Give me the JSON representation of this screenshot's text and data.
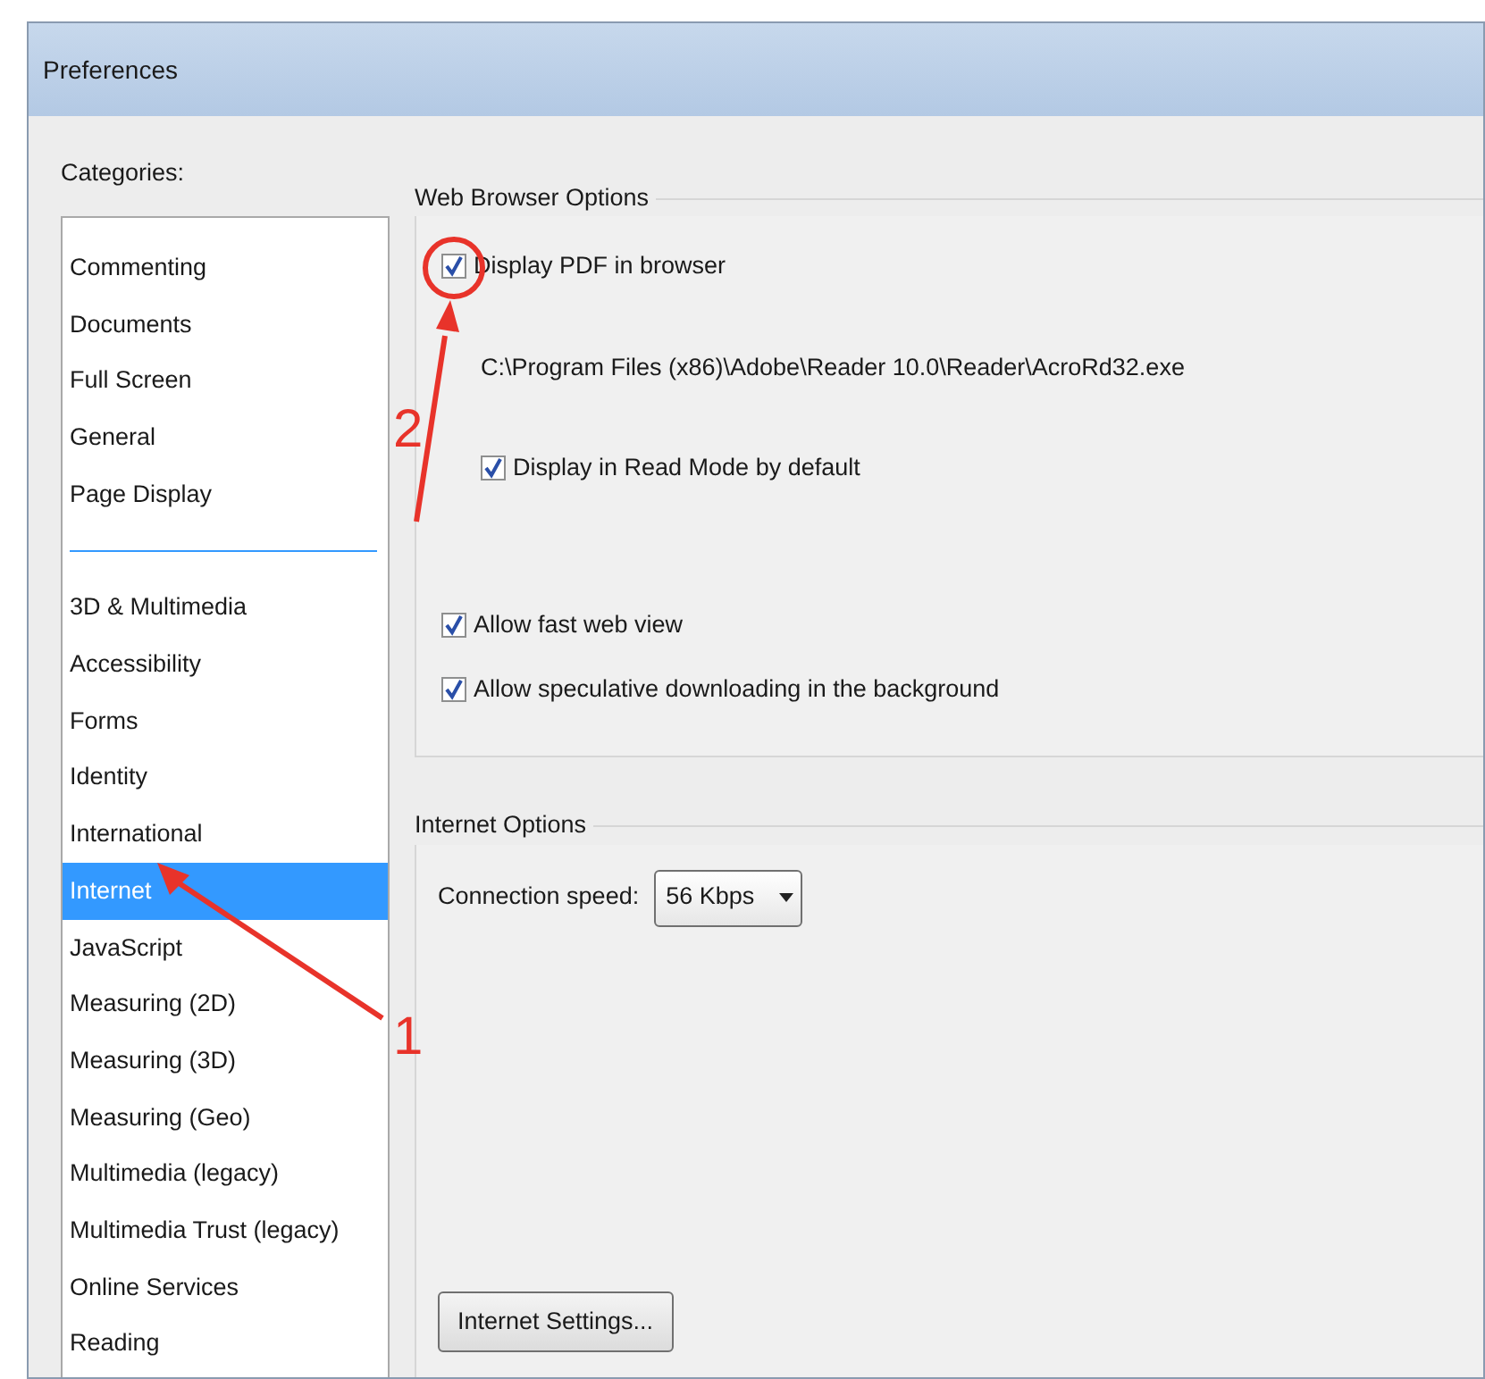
{
  "window": {
    "title": "Preferences"
  },
  "categories": {
    "label": "Categories:",
    "groups": [
      [
        {
          "label": "Commenting",
          "selected": false
        },
        {
          "label": "Documents",
          "selected": false
        },
        {
          "label": "Full Screen",
          "selected": false
        },
        {
          "label": "General",
          "selected": false
        },
        {
          "label": "Page Display",
          "selected": false
        }
      ],
      [
        {
          "label": "3D & Multimedia",
          "selected": false
        },
        {
          "label": "Accessibility",
          "selected": false
        },
        {
          "label": "Forms",
          "selected": false
        },
        {
          "label": "Identity",
          "selected": false
        },
        {
          "label": "International",
          "selected": false
        },
        {
          "label": "Internet",
          "selected": true
        },
        {
          "label": "JavaScript",
          "selected": false
        },
        {
          "label": "Measuring (2D)",
          "selected": false
        },
        {
          "label": "Measuring (3D)",
          "selected": false
        },
        {
          "label": "Measuring (Geo)",
          "selected": false
        },
        {
          "label": "Multimedia (legacy)",
          "selected": false
        },
        {
          "label": "Multimedia Trust (legacy)",
          "selected": false
        },
        {
          "label": "Online Services",
          "selected": false
        },
        {
          "label": "Reading",
          "selected": false
        }
      ]
    ]
  },
  "web_browser_options": {
    "title": "Web Browser Options",
    "browser_options": [
      {
        "kind": "checkbox",
        "label": "Display PDF in browser",
        "checked": true
      },
      {
        "kind": "path",
        "label": "C:\\Program Files (x86)\\Adobe\\Reader 10.0\\Reader\\AcroRd32.exe"
      },
      {
        "kind": "subcheckbox",
        "label": "Display in Read Mode by default",
        "checked": true
      }
    ],
    "download_options": [
      {
        "kind": "checkbox",
        "label": "Allow fast web view",
        "checked": true
      },
      {
        "kind": "checkbox",
        "label": "Allow speculative downloading in the background",
        "checked": true
      }
    ]
  },
  "internet_options": {
    "title": "Internet Options",
    "connection_speed": {
      "label": "Connection speed:",
      "value": "56 Kbps"
    },
    "settings_button": "Internet Settings..."
  },
  "annotations": [
    {
      "label": "2"
    },
    {
      "label": "1"
    }
  ]
}
